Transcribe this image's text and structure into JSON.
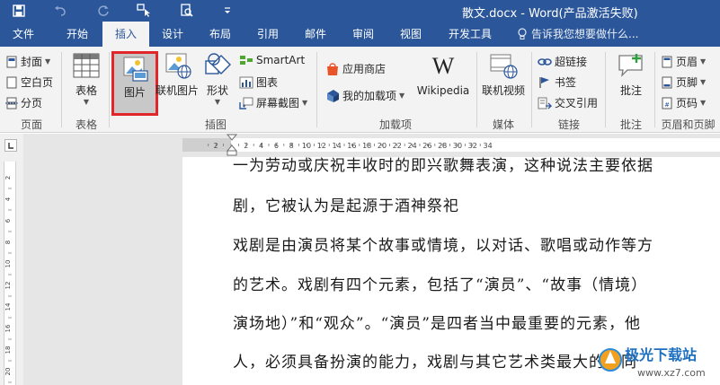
{
  "window": {
    "title": "散文.docx - Word(产品激活失败)"
  },
  "quick_access": [
    "save-icon",
    "undo-icon",
    "redo-icon",
    "touch-mode-icon",
    "print-preview-icon",
    "customize-icon"
  ],
  "tabs": [
    {
      "label": "文件"
    },
    {
      "label": "开始"
    },
    {
      "label": "插入"
    },
    {
      "label": "设计"
    },
    {
      "label": "布局"
    },
    {
      "label": "引用"
    },
    {
      "label": "邮件"
    },
    {
      "label": "审阅"
    },
    {
      "label": "视图"
    },
    {
      "label": "开发工具"
    }
  ],
  "active_tab": "插入",
  "tell_me": "告诉我您想要做什么...",
  "ribbon": {
    "pages": {
      "cover": "封面",
      "blank": "空白页",
      "break": "分页",
      "group": "页面"
    },
    "tables": {
      "table": "表格",
      "group": "表格"
    },
    "illustrations": {
      "picture": "图片",
      "online_picture": "联机图片",
      "shapes": "形状",
      "smartart": "SmartArt",
      "chart": "图表",
      "screenshot": "屏幕截图",
      "group": "插图"
    },
    "addins": {
      "store": "应用商店",
      "my_addins": "我的加载项",
      "wikipedia": "Wikipedia",
      "group": "加载项"
    },
    "media": {
      "online_video": "联机视频",
      "group": "媒体"
    },
    "links": {
      "hyperlink": "超链接",
      "bookmark": "书签",
      "crossref": "交叉引用",
      "group": "链接"
    },
    "comments": {
      "comment": "批注",
      "group": "批注"
    },
    "header_footer": {
      "header": "页眉",
      "footer": "页脚",
      "page_number": "页码",
      "group": "页眉和页脚"
    }
  },
  "ruler": {
    "marks": [
      "2",
      "2",
      "4",
      "6",
      "8",
      "10",
      "12",
      "14",
      "16",
      "18",
      "20",
      "22",
      "24",
      "26",
      "28",
      "30",
      "32",
      "34"
    ],
    "vmarks": [
      "2",
      "4",
      "6",
      "8",
      "10",
      "12",
      "14",
      "16",
      "18",
      "20"
    ]
  },
  "document": {
    "lines": [
      "一为劳动或庆祝丰收时的即兴歌舞表演，这种说法主要依据",
      "剧，它被认为是起源于酒神祭祀",
      "戏剧是由演员将某个故事或情境，以对话、歌唱或动作等方",
      "的艺术。戏剧有四个元素，包括了“演员”、“故事（情境）",
      "演场地）”和“观众”。“演员”是四者当中最重要的元素，他",
      "人，必须具备扮演的能力，戏剧与其它艺术类最大的不同"
    ]
  },
  "watermark": {
    "title": "极光下载站",
    "url": "www.xz7.com"
  },
  "colors": {
    "title_bar": "#2b579a",
    "ribbon_bg": "#f3f3f3",
    "highlight": "#e0262b"
  }
}
